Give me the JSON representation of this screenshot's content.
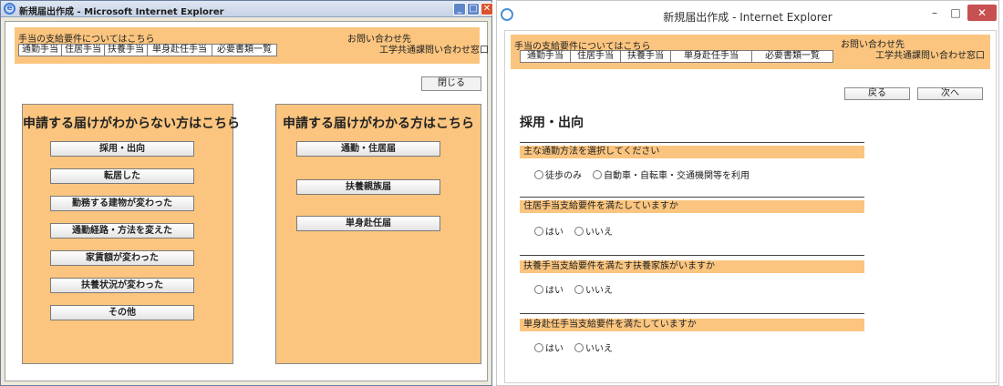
{
  "left_window": {
    "title": "新規届出作成 - Microsoft Internet Explorer",
    "header": {
      "help_link": "手当の支給要件についてはこちら",
      "tabs": [
        "通勤手当",
        "住居手当",
        "扶養手当",
        "単身赴任手当",
        "必要書類一覧"
      ],
      "contact_title": "お問い合わせ先",
      "contact_name": "工学共通課問い合わせ窓口"
    },
    "close_button": "閉じる",
    "panel_unknown": {
      "title": "申請する届けがわからない方はこちら",
      "buttons": [
        "採用・出向",
        "転居した",
        "勤務する建物が変わった",
        "通勤経路・方法を変えた",
        "家賃額が変わった",
        "扶養状況が変わった",
        "その他"
      ]
    },
    "panel_known": {
      "title": "申請する届けがわかる方はこちら",
      "buttons": [
        "通勤・住居届",
        "扶養親族届",
        "単身赴任届"
      ]
    }
  },
  "right_window": {
    "title": "新規届出作成 - Internet Explorer",
    "header": {
      "help_link": "手当の支給要件についてはこちら",
      "tabs": [
        "通勤手当",
        "住居手当",
        "扶養手当",
        "単身赴任手当",
        "必要書類一覧"
      ],
      "contact_title": "お問い合わせ先",
      "contact_name": "工学共通課問い合わせ窓口"
    },
    "back_button": "戻る",
    "next_button": "次へ",
    "section_title": "採用・出向",
    "questions": [
      {
        "label": "主な通勤方法を選択してください",
        "options": [
          "徒歩のみ",
          "自動車・自転車・交通機関等を利用"
        ]
      },
      {
        "label": "住居手当支給要件を満たしていますか",
        "options": [
          "はい",
          "いいえ"
        ]
      },
      {
        "label": "扶養手当支給要件を満たす扶養家族がいますか",
        "options": [
          "はい",
          "いいえ"
        ]
      },
      {
        "label": "単身赴任手当支給要件を満たしていますか",
        "options": [
          "はい",
          "いいえ"
        ]
      }
    ]
  },
  "colors": {
    "accent_orange": "#fbc57f",
    "xp_close_red": "#d9542e",
    "win8_close_red": "#c75050"
  }
}
